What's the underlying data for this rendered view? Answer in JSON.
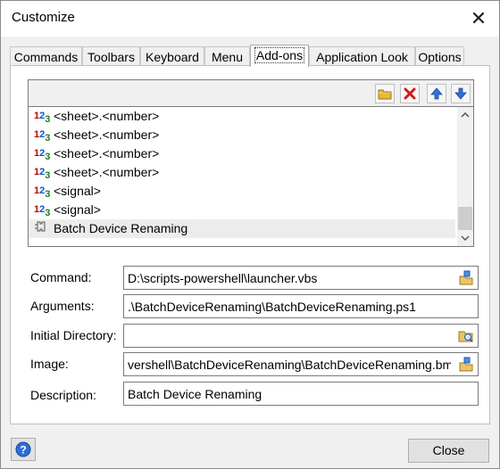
{
  "window": {
    "title": "Customize",
    "close_glyph": "✕"
  },
  "tabs": [
    {
      "label": "Commands"
    },
    {
      "label": "Toolbars"
    },
    {
      "label": "Keyboard"
    },
    {
      "label": "Menu"
    },
    {
      "label": "Add-ons",
      "active": true
    },
    {
      "label": "Application Look"
    },
    {
      "label": "Options"
    }
  ],
  "list_toolbar": {
    "buttons": [
      "new-folder-icon",
      "delete-icon",
      "move-up-icon",
      "move-down-icon"
    ]
  },
  "list": {
    "items": [
      {
        "icon": "numbers-icon",
        "label": "<sheet>.<number>"
      },
      {
        "icon": "numbers-icon",
        "label": "<sheet>.<number>"
      },
      {
        "icon": "numbers-icon",
        "label": "<sheet>.<number>"
      },
      {
        "icon": "numbers-icon",
        "label": "<sheet>.<number>"
      },
      {
        "icon": "numbers-icon",
        "label": "<signal>"
      },
      {
        "icon": "numbers-icon",
        "label": "<signal>"
      },
      {
        "icon": "addon-icon",
        "label": "Batch Device Renaming",
        "selected": true
      }
    ]
  },
  "form": {
    "command": {
      "label": "Command:",
      "value": "D:\\scripts-powershell\\launcher.vbs"
    },
    "arguments": {
      "label": "Arguments:",
      "value": ".\\BatchDeviceRenaming\\BatchDeviceRenaming.ps1"
    },
    "initial_directory": {
      "label": "Initial Directory:",
      "value": ""
    },
    "image": {
      "label": "Image:",
      "value": "vershell\\BatchDeviceRenaming\\BatchDeviceRenaming.bmp"
    },
    "description": {
      "label": "Description:",
      "value": "Batch Device Renaming"
    }
  },
  "footer": {
    "help_glyph": "?",
    "close_label": "Close"
  },
  "colors": {
    "accent": "#0a56c8",
    "selection": "#ececec"
  }
}
